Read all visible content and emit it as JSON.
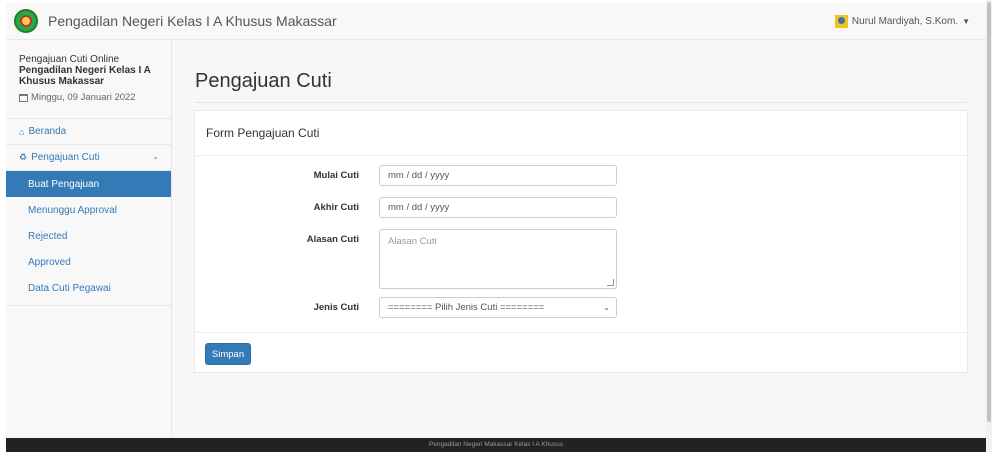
{
  "header": {
    "title": "Pengadilan Negeri Kelas I A Khusus Makassar",
    "user_name": "Nurul Mardiyah, S.Kom."
  },
  "sidebar": {
    "app_line1": "Pengajuan Cuti Online",
    "app_line2": "Pengadilan Negeri Kelas I A",
    "app_line3": "Khusus Makassar",
    "date": "Minggu, 09 Januari 2022",
    "items": [
      {
        "label": "Beranda",
        "icon": "home-icon"
      },
      {
        "label": "Pengajuan Cuti",
        "icon": "recycle-icon"
      }
    ],
    "subitems": [
      {
        "label": "Buat Pengajuan",
        "active": true
      },
      {
        "label": "Menunggu Approval"
      },
      {
        "label": "Rejected"
      },
      {
        "label": "Approved"
      },
      {
        "label": "Data Cuti Pegawai"
      }
    ]
  },
  "main": {
    "page_title": "Pengajuan Cuti",
    "panel_title": "Form Pengajuan Cuti",
    "form": {
      "mulai_label": "Mulai Cuti",
      "mulai_value": "mm / dd / yyyy",
      "akhir_label": "Akhir Cuti",
      "akhir_value": "mm / dd / yyyy",
      "alasan_label": "Alasan Cuti",
      "alasan_placeholder": "Alasan Cuti",
      "jenis_label": "Jenis Cuti",
      "jenis_selected": "======== Pilih Jenis Cuti ========"
    },
    "submit_label": "Simpan"
  },
  "footer": {
    "text": "Pengadilan Negeri Makassar Kelas I A Khusus"
  },
  "colors": {
    "primary": "#337ab7",
    "navbar_bg": "#f8f8f8",
    "footer_bg": "#222222"
  }
}
